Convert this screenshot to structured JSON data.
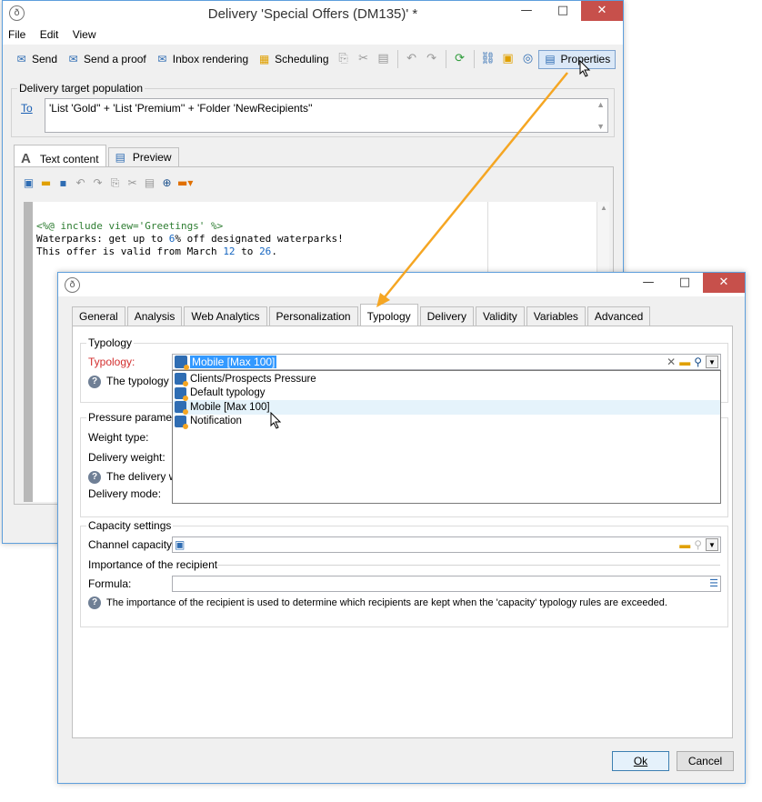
{
  "main_window": {
    "title": "Delivery 'Special Offers (DM135)' *",
    "menu": [
      "File",
      "Edit",
      "View"
    ],
    "toolbar": {
      "send": "Send",
      "send_proof": "Send a proof",
      "inbox_rendering": "Inbox rendering",
      "scheduling": "Scheduling",
      "properties": "Properties"
    },
    "target": {
      "legend": "Delivery target population",
      "to_link": "To",
      "value": "'List 'Gold'' + 'List 'Premium'' + 'Folder 'NewRecipients''"
    },
    "content_tabs": [
      "Text content",
      "Preview"
    ],
    "code": {
      "line1": "<%@ include view='Greetings' %>",
      "line2_a": "Waterparks: get up to ",
      "line2_b": "6",
      "line2_c": "% off designated waterparks!",
      "line3_a": "This offer is valid from March ",
      "line3_b": "12",
      "line3_c": " to ",
      "line3_d": "26",
      "line3_e": "."
    }
  },
  "dialog": {
    "tabs": [
      "General",
      "Analysis",
      "Web Analytics",
      "Personalization",
      "Typology",
      "Delivery",
      "Validity",
      "Variables",
      "Advanced"
    ],
    "active_tab": "Typology",
    "typology_section": {
      "legend": "Typology",
      "label": "Typology:",
      "selected": "Mobile [Max 100]",
      "help_text": "The typology is",
      "options": [
        "Clients/Prospects Pressure",
        "Default typology",
        "Mobile [Max 100]",
        "Notification"
      ]
    },
    "pressure_section": {
      "legend": "Pressure parameter",
      "weight_type": "Weight type:",
      "delivery_weight": "Delivery weight:",
      "help_text": "The delivery we",
      "delivery_mode": "Delivery mode:"
    },
    "capacity_section": {
      "legend": "Capacity settings",
      "channel_capacity": "Channel capacity:",
      "importance_legend": "Importance of the recipient",
      "formula": "Formula:",
      "help_text": "The importance of the recipient is used to determine which recipients are kept when the 'capacity' typology rules are exceeded."
    },
    "buttons": {
      "ok": "Ok",
      "cancel": "Cancel"
    }
  },
  "colors": {
    "accent": "#f5a623",
    "window_border": "#5e9fdc",
    "close_button": "#c7504b",
    "required_label": "#d32f2f"
  }
}
